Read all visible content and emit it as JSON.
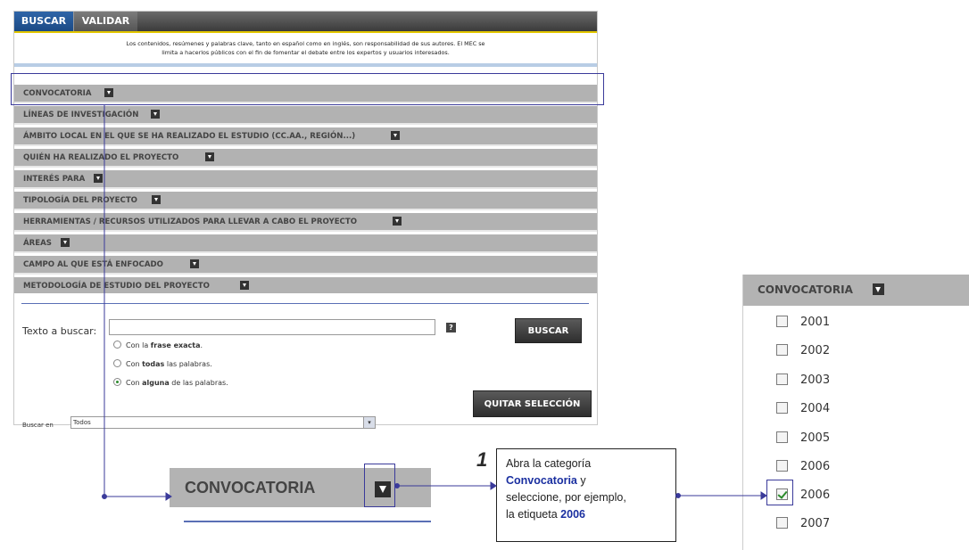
{
  "tabs": [
    {
      "label": "BUSCAR",
      "active": true
    },
    {
      "label": "VALIDAR",
      "active": false
    }
  ],
  "disclaimer": {
    "line1": "Los contenidos, resúmenes y palabras clave, tanto en español como en inglés, son responsabilidad de sus autores. El MEC se",
    "line2": "limita a hacerlos públicos con el fin de fomentar el debate entre los expertos y usuarios interesados."
  },
  "categories": [
    "CONVOCATORIA",
    "LÍNEAS DE INVESTIGACIÓN",
    "ÁMBITO LOCAL EN EL QUE SE HA REALIZADO EL ESTUDIO (CC.AA., REGIÓN...)",
    "QUIÉN HA REALIZADO EL PROYECTO",
    "INTERÉS PARA",
    "TIPOLOGÍA DEL PROYECTO",
    "HERRAMIENTAS / RECURSOS UTILIZADOS PARA LLEVAR A CABO EL PROYECTO",
    "ÁREAS",
    "CAMPO AL QUE ESTÁ ENFOCADO",
    "METODOLOGÍA DE ESTUDIO DEL PROYECTO"
  ],
  "search": {
    "label": "Texto a buscar:",
    "value": "",
    "help": "?",
    "button": "BUSCAR",
    "options": {
      "exact": {
        "pre": "Con la ",
        "bold": "frase exacta",
        "post": "."
      },
      "all": {
        "pre": "Con ",
        "bold": "todas",
        "post": " las palabras."
      },
      "any": {
        "pre": "Con ",
        "bold": "alguna",
        "post": " de las palabras."
      }
    },
    "selected_option": "any",
    "clear_button": "QUITAR SELECCIÓN",
    "scope_label": "Buscar en",
    "scope_value": "Todos"
  },
  "zoom": {
    "label": "CONVOCATORIA"
  },
  "callout": {
    "step": "1",
    "line1": "Abra la categoría",
    "highlight1": "Convocatoria",
    "line2": " y",
    "line3": "seleccione, por ejemplo,",
    "line4": "la etiqueta ",
    "highlight2": "2006"
  },
  "right_panel": {
    "header": "CONVOCATORIA",
    "years": [
      {
        "label": "2001",
        "checked": false
      },
      {
        "label": "2002",
        "checked": false
      },
      {
        "label": "2003",
        "checked": false
      },
      {
        "label": "2004",
        "checked": false
      },
      {
        "label": "2005",
        "checked": false
      },
      {
        "label": "2006",
        "checked": false
      },
      {
        "label": "2006",
        "checked": true
      },
      {
        "label": "2007",
        "checked": false
      }
    ]
  },
  "colors": {
    "accent_blue": "#1b4a85",
    "frame": "#3a3a9a",
    "category_bg": "#b2b2b2",
    "check_green": "#2a8a2a"
  }
}
